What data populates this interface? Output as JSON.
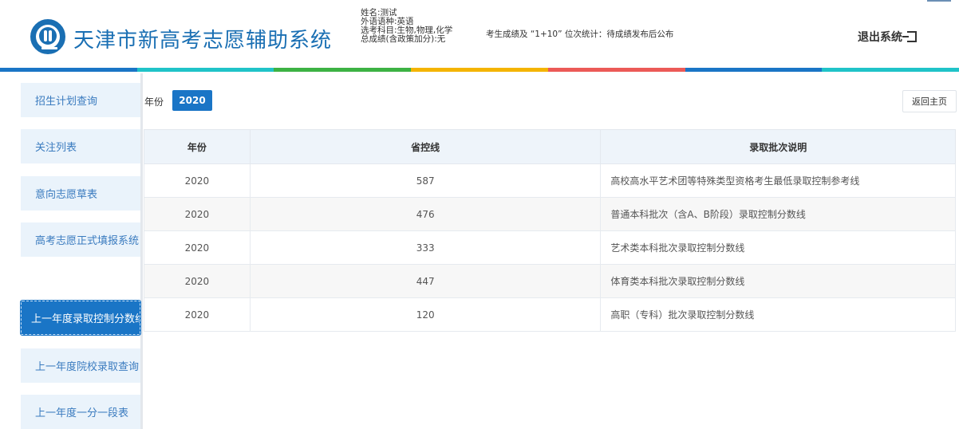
{
  "header": {
    "title": "天津市新高考志愿辅助系统",
    "user_info": {
      "name": "姓名:测试",
      "language": "外语语种:英语",
      "subjects": "选考科目:生物,物理,化学",
      "score": "总成绩(含政策加分):无"
    },
    "notice": "考生成绩及 “1+10” 位次统计：待成绩发布后公布",
    "logout_label": "退出系统",
    "brand_color": "#1a6fb3"
  },
  "color_bar": [
    "#1a75c6",
    "#20c3c8",
    "#3db244",
    "#f4b400",
    "#ec5a57",
    "#1a75c6",
    "#20c3c8"
  ],
  "sidebar": {
    "items": [
      {
        "label": "招生计划查询",
        "active": false
      },
      {
        "label": "关注列表",
        "active": false
      },
      {
        "label": "意向志愿草表",
        "active": false
      },
      {
        "label": "高考志愿正式填报系统",
        "active": false
      },
      {
        "label": "上一年度录取控制分数线",
        "active": true
      },
      {
        "label": "上一年度院校录取查询",
        "active": false
      },
      {
        "label": "上一年度一分一段表",
        "active": false
      }
    ]
  },
  "filter": {
    "year_label": "年份",
    "year_value": "2020"
  },
  "back_button": "返回主页",
  "table": {
    "columns": [
      "年份",
      "省控线",
      "录取批次说明"
    ],
    "rows": [
      {
        "year": "2020",
        "line": "587",
        "desc": "高校高水平艺术团等特殊类型资格考生最低录取控制参考线"
      },
      {
        "year": "2020",
        "line": "476",
        "desc": "普通本科批次（含A、B阶段）录取控制分数线"
      },
      {
        "year": "2020",
        "line": "333",
        "desc": "艺术类本科批次录取控制分数线"
      },
      {
        "year": "2020",
        "line": "447",
        "desc": "体育类本科批次录取控制分数线"
      },
      {
        "year": "2020",
        "line": "120",
        "desc": "高职（专科）批次录取控制分数线"
      }
    ]
  }
}
